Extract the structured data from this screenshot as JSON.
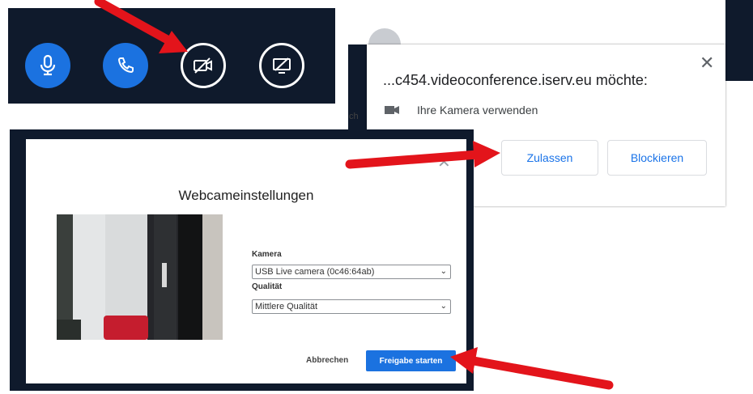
{
  "toolbar": {
    "buttons": [
      {
        "icon": "microphone-icon",
        "style": "blue"
      },
      {
        "icon": "phone-icon",
        "style": "blue"
      },
      {
        "icon": "camera-off-icon",
        "style": "ring"
      },
      {
        "icon": "screen-share-off-icon",
        "style": "ring"
      }
    ]
  },
  "permission": {
    "title": "...c454.videoconference.iserv.eu möchte:",
    "request": "Ihre Kamera verwenden",
    "allow_label": "Zulassen",
    "block_label": "Blockieren",
    "close": "✕",
    "behind_text": "ch"
  },
  "dialog": {
    "title": "Webcameinstellungen",
    "close": "✕",
    "camera_label": "Kamera",
    "camera_value": "USB Live camera (0c46:64ab)",
    "quality_label": "Qualität",
    "quality_value": "Mittlere Qualität",
    "cancel_label": "Abbrechen",
    "share_label": "Freigabe starten"
  },
  "colors": {
    "accent": "#1b72e0",
    "toolbar_bg": "#0f1a2c",
    "link_blue": "#1a73e8",
    "arrow": "#e3141b"
  }
}
